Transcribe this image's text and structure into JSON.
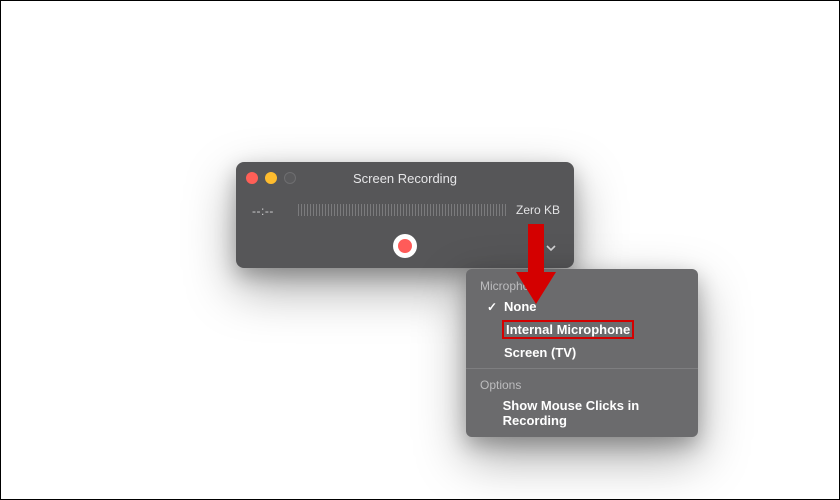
{
  "window": {
    "title": "Screen Recording",
    "timecode": "--:--",
    "filesize": "Zero KB"
  },
  "menu": {
    "section_mic": "Microphone",
    "item_none": "None",
    "item_internal": "Internal Microphone",
    "item_screen_tv": "Screen (TV)",
    "section_options": "Options",
    "item_show_clicks": "Show Mouse Clicks in Recording"
  }
}
